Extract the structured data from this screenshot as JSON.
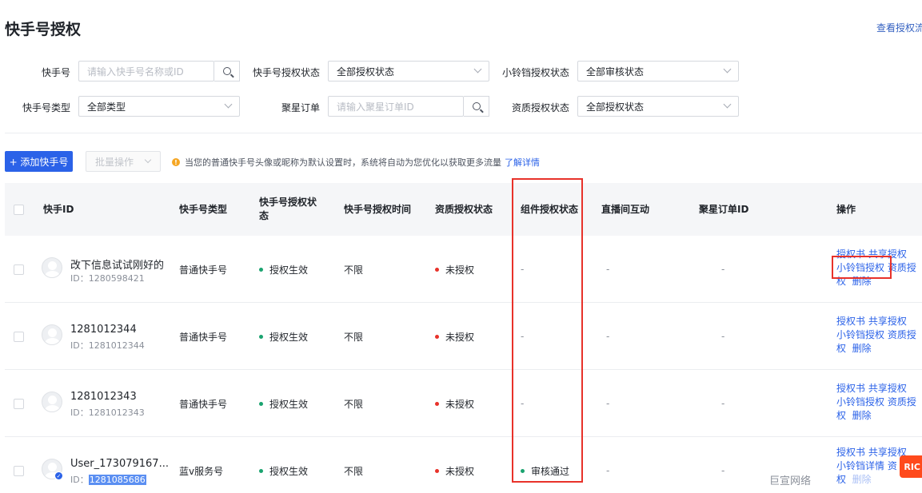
{
  "page": {
    "title": "快手号授权",
    "flow_link": "查看授权流"
  },
  "filters": {
    "account_label": "快手号",
    "account_placeholder": "请输入快手号名称或ID",
    "auth_status_label": "快手号授权状态",
    "auth_status_value": "全部授权状态",
    "bell_status_label": "小铃铛授权状态",
    "bell_status_value": "全部审核状态",
    "account_type_label": "快手号类型",
    "account_type_value": "全部类型",
    "xingtu_label": "聚星订单",
    "xingtu_placeholder": "请输入聚星订单ID",
    "qualification_label": "资质授权状态",
    "qualification_value": "全部授权状态"
  },
  "toolbar": {
    "add_label": "+ 添加快手号",
    "batch_label": "批量操作",
    "notice_text": "当您的普通快手号头像或昵称为默认设置时，系统将自动为您优化以获取更多流量",
    "notice_link": "了解详情"
  },
  "table": {
    "headers": {
      "account_id": "快手ID",
      "account_type": "快手号类型",
      "auth_status_l1": "快手号授权状",
      "auth_status_l2": "态",
      "auth_time": "快手号授权时间",
      "qualification": "资质授权状态",
      "component": "组件授权状态",
      "live_interaction": "直播间互动",
      "xingtu_order": "聚星订单ID",
      "actions": "操作"
    },
    "rows": [
      {
        "name": "改下信息试试刚好的",
        "id": "1280598421",
        "type": "普通快手号",
        "auth_status": "授权生效",
        "auth_time": "不限",
        "qualification": "未授权",
        "component": "-",
        "live": "-",
        "order": "-",
        "actions": {
          "a1": "授权书",
          "a2": "共享授权",
          "a3": "小铃铛授权",
          "a4": "资质授",
          "a5": "权",
          "a6": "删除"
        }
      },
      {
        "name": "1281012344",
        "id": "1281012344",
        "type": "普通快手号",
        "auth_status": "授权生效",
        "auth_time": "不限",
        "qualification": "未授权",
        "component": "-",
        "live": "-",
        "order": "-",
        "actions": {
          "a1": "授权书",
          "a2": "共享授权",
          "a3": "小铃铛授权",
          "a4": "资质授",
          "a5": "权",
          "a6": "删除"
        }
      },
      {
        "name": "1281012343",
        "id": "1281012343",
        "type": "普通快手号",
        "auth_status": "授权生效",
        "auth_time": "不限",
        "qualification": "未授权",
        "component": "-",
        "live": "-",
        "order": "-",
        "actions": {
          "a1": "授权书",
          "a2": "共享授权",
          "a3": "小铃铛授权",
          "a4": "资质授",
          "a5": "权",
          "a6": "删除"
        }
      },
      {
        "name": "User_173079167...",
        "id": "1281085686",
        "type": "蓝v服务号",
        "auth_status": "授权生效",
        "auth_time": "不限",
        "qualification": "未授权",
        "component": "审核通过",
        "live": "-",
        "order": "-",
        "actions": {
          "a1": "授权书",
          "a2": "共享授权",
          "a3": "小铃铛详情",
          "a4": "资",
          "a5": "权",
          "a6": "删除"
        }
      }
    ],
    "id_prefix": "ID："
  },
  "colors": {
    "primary": "#2b62e8",
    "success_dot": "#1aa36f",
    "error_dot": "#e8322a",
    "highlight_box": "#e8322a"
  },
  "watermark": "巨宣网络",
  "float_badge": "RIC"
}
